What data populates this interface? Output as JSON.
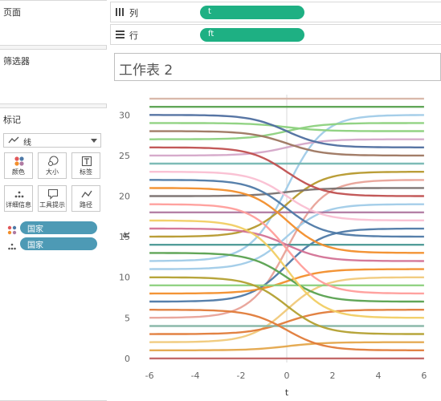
{
  "shelves": {
    "columns": {
      "label": "列",
      "pill": "t"
    },
    "rows": {
      "label": "行",
      "pill": "ft"
    }
  },
  "panels": {
    "pages": "页面",
    "filters": "筛选器",
    "marks": "标记"
  },
  "marks": {
    "type_label": "线",
    "buttons": [
      {
        "id": "color",
        "label": "颜色"
      },
      {
        "id": "size",
        "label": "大小"
      },
      {
        "id": "label",
        "label": "标签"
      },
      {
        "id": "detail",
        "label": "详细信息"
      },
      {
        "id": "tooltip",
        "label": "工具提示"
      },
      {
        "id": "path",
        "label": "路径"
      }
    ],
    "fields": [
      {
        "encoding": "color",
        "name": "国家"
      },
      {
        "encoding": "detail",
        "name": "国家"
      }
    ]
  },
  "sheet": {
    "title": "工作表 2"
  },
  "colors": {
    "accent_green": "#1eb083",
    "field_blue": "#4d9ab5"
  },
  "chart_data": {
    "type": "line",
    "title": "",
    "xlabel": "t",
    "ylabel": "ft",
    "xlim": [
      -6.6,
      6.6
    ],
    "ylim": [
      -0.5,
      32.5
    ],
    "xticks": [
      -6,
      -4,
      -2,
      0,
      2,
      4,
      6
    ],
    "yticks": [
      0,
      5,
      10,
      15,
      20,
      25,
      30
    ],
    "grid": {
      "horizontal": false,
      "zero_line_x": true
    },
    "legend": "none",
    "series": [
      {
        "color": "#c06161",
        "start": 0,
        "end": 0
      },
      {
        "color": "#e4a74b",
        "start": 1,
        "end": 2
      },
      {
        "color": "#f0c97a",
        "start": 2,
        "end": 10
      },
      {
        "color": "#e07b39",
        "start": 3,
        "end": 6
      },
      {
        "color": "#86b5a5",
        "start": 4,
        "end": 4
      },
      {
        "color": "#e8a298",
        "start": 5,
        "end": 22
      },
      {
        "color": "#e07b39",
        "start": 6,
        "end": 1
      },
      {
        "color": "#4e79a7",
        "start": 7,
        "end": 16
      },
      {
        "color": "#f28e2b",
        "start": 8,
        "end": 11
      },
      {
        "color": "#8cd17d",
        "start": 9,
        "end": 9
      },
      {
        "color": "#b3a030",
        "start": 10,
        "end": 3
      },
      {
        "color": "#a0cbe8",
        "start": 11,
        "end": 19
      },
      {
        "color": "#a0cbe8",
        "start": 12,
        "end": 30
      },
      {
        "color": "#59a14f",
        "start": 13,
        "end": 7
      },
      {
        "color": "#499894",
        "start": 14,
        "end": 14
      },
      {
        "color": "#b6992d",
        "start": 15,
        "end": 23
      },
      {
        "color": "#d37295",
        "start": 16,
        "end": 12
      },
      {
        "color": "#f1ce63",
        "start": 17,
        "end": 5
      },
      {
        "color": "#b07aa1",
        "start": 18,
        "end": 18
      },
      {
        "color": "#ff9d9a",
        "start": 19,
        "end": 8
      },
      {
        "color": "#79706e",
        "start": 20,
        "end": 21
      },
      {
        "color": "#f28e2b",
        "start": 21,
        "end": 13
      },
      {
        "color": "#4e79a7",
        "start": 22,
        "end": 15
      },
      {
        "color": "#fabfd2",
        "start": 23,
        "end": 17
      },
      {
        "color": "#76b7b2",
        "start": 24,
        "end": 24
      },
      {
        "color": "#d4a6c8",
        "start": 25,
        "end": 27
      },
      {
        "color": "#c05050",
        "start": 26,
        "end": 20
      },
      {
        "color": "#8cd17d",
        "start": 27,
        "end": 29
      },
      {
        "color": "#9d7660",
        "start": 28,
        "end": 25
      },
      {
        "color": "#8cd17d",
        "start": 29,
        "end": 28
      },
      {
        "color": "#4e6e9f",
        "start": 30,
        "end": 26
      },
      {
        "color": "#59a14f",
        "start": 31,
        "end": 31
      },
      {
        "color": "#d7b5a6",
        "start": 32,
        "end": 32
      }
    ]
  }
}
